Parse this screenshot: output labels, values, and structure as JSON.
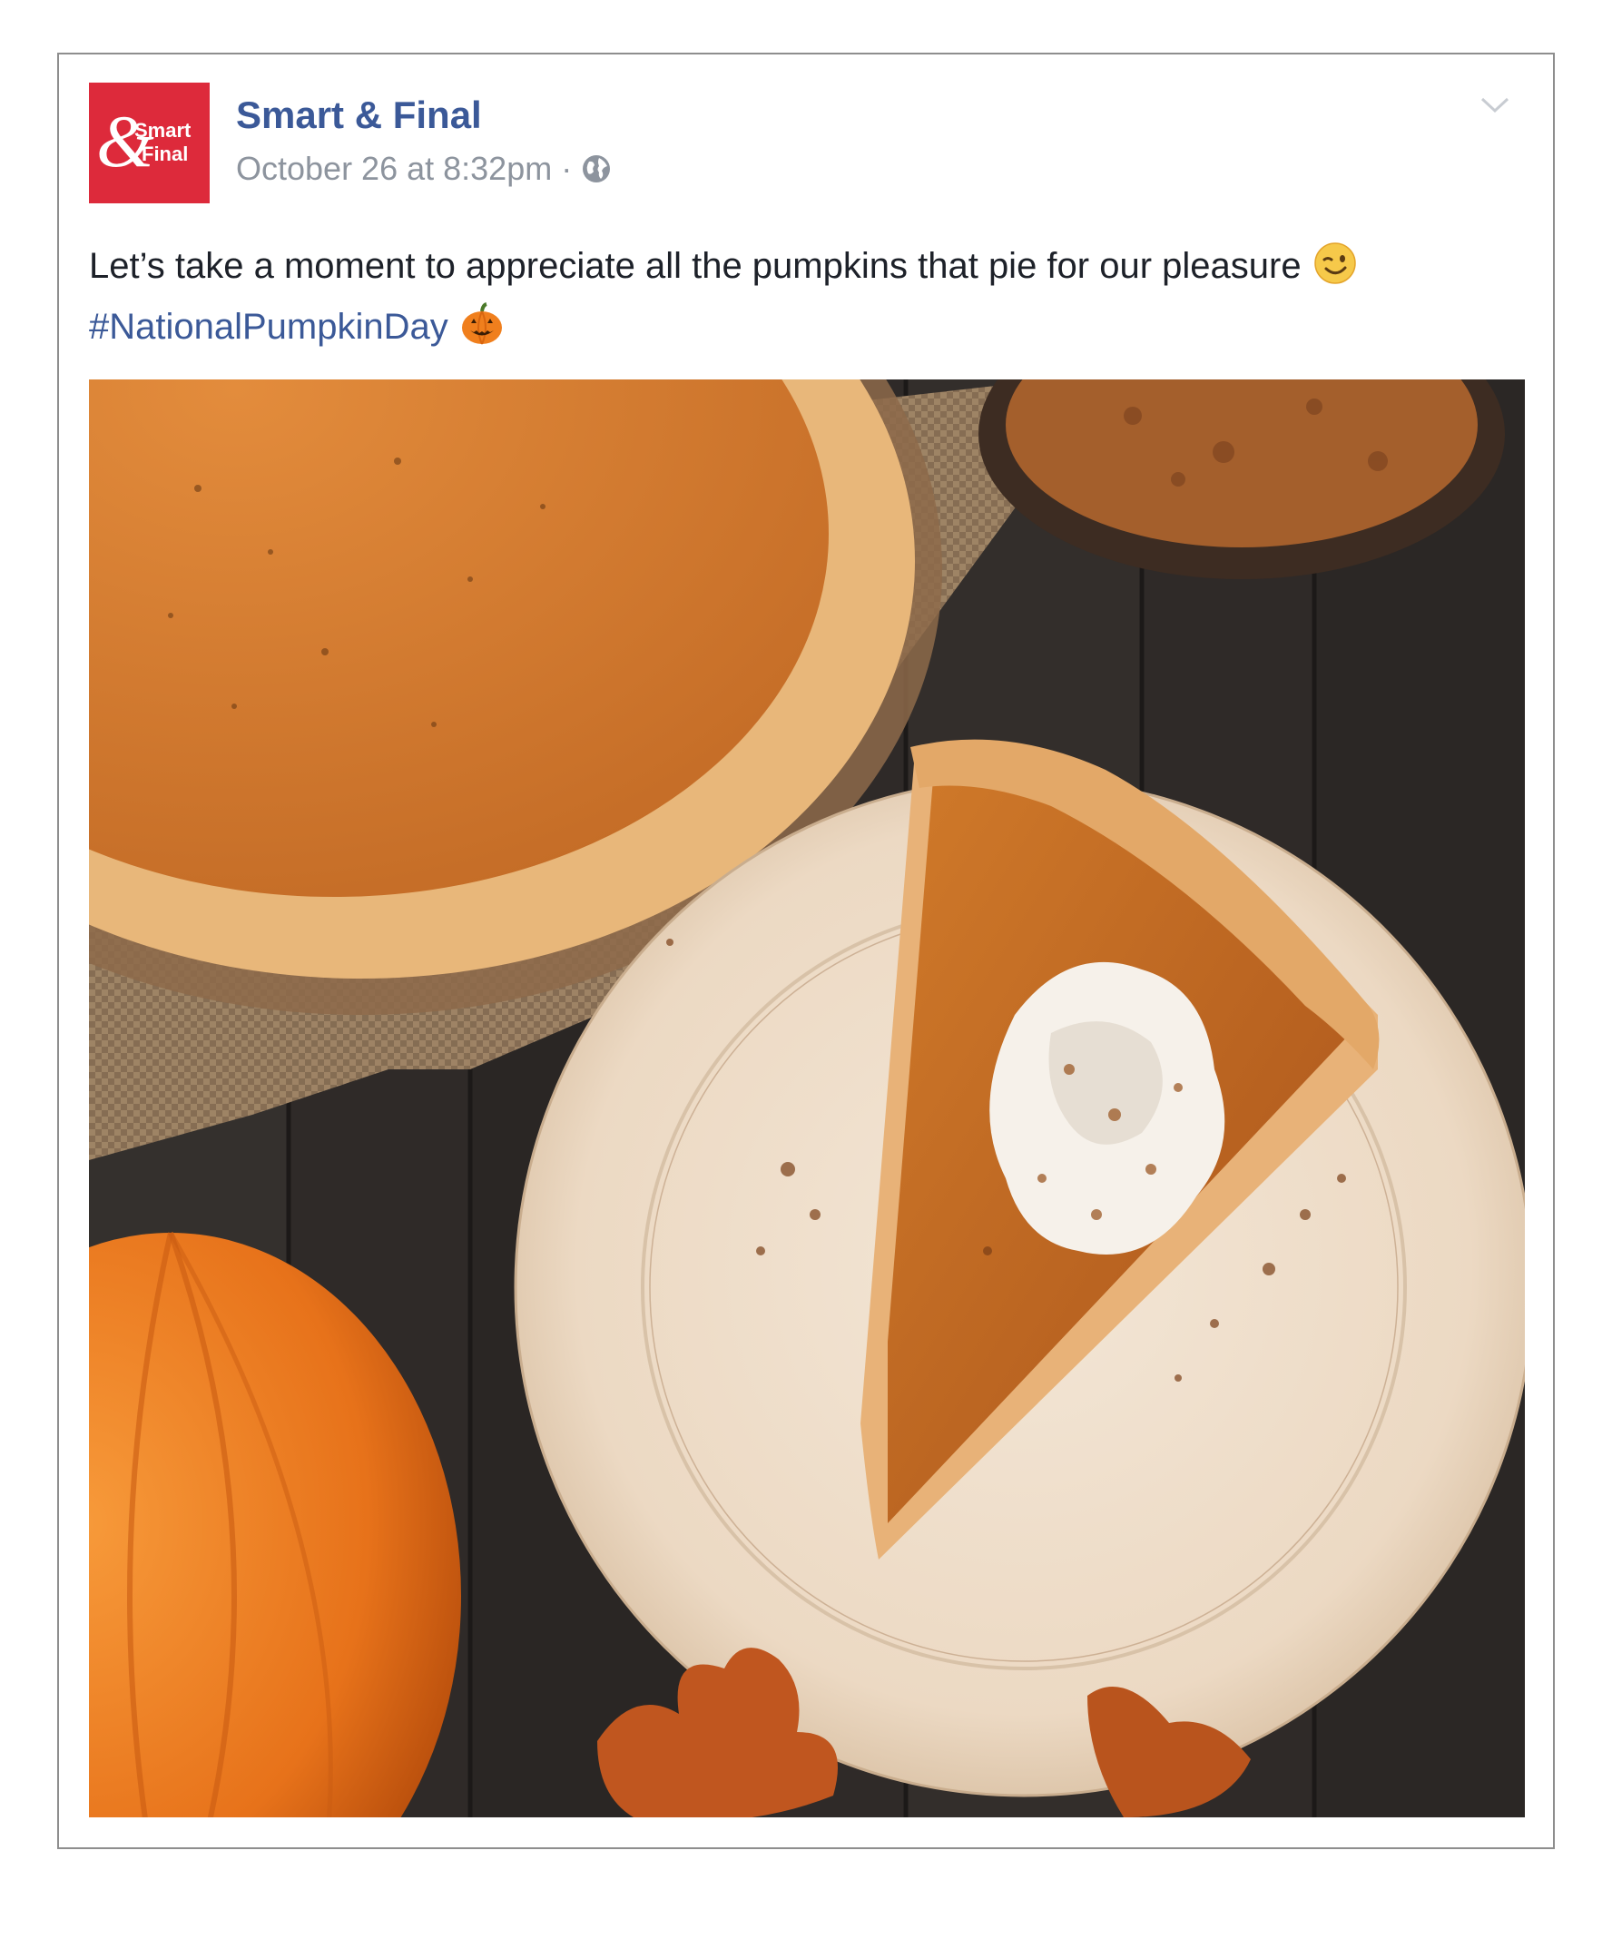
{
  "post": {
    "page_name": "Smart & Final",
    "timestamp": "October 26 at 8:32pm",
    "separator": "·",
    "privacy_icon": "globe-icon",
    "options_icon": "chevron-down-icon",
    "avatar": {
      "logo_text": "Smart & Final",
      "bg_color": "#dd2a3b"
    },
    "message": {
      "text": "Let’s take a moment to appreciate all the pumpkins that pie for our pleasure",
      "emoji_1": "winking-face-emoji",
      "hashtag": "#NationalPumpkinDay",
      "emoji_2": "jack-o-lantern-emoji"
    },
    "photo": {
      "subject": "pumpkin-pie-slice-photo"
    }
  },
  "colors": {
    "link": "#3b5998",
    "meta": "#8d949e",
    "text": "#1d2129"
  }
}
